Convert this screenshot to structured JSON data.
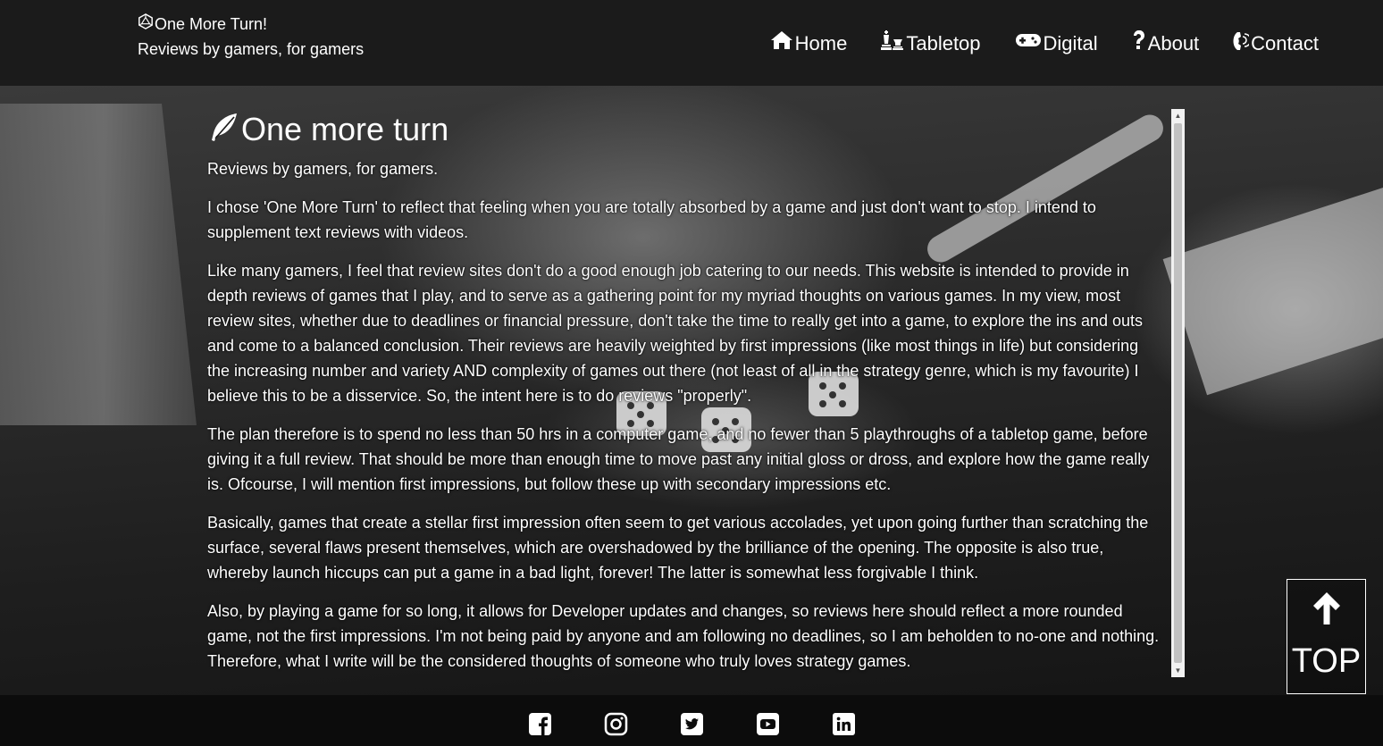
{
  "header": {
    "brand_title": "One More Turn!",
    "brand_subtitle": "Reviews by gamers, for gamers",
    "brand_icon": "d20-dice-icon"
  },
  "nav": {
    "items": [
      {
        "label": "Home",
        "icon": "home-icon"
      },
      {
        "label": "Tabletop",
        "icon": "chess-pieces-icon"
      },
      {
        "label": "Digital",
        "icon": "gamepad-icon"
      },
      {
        "label": "About",
        "icon": "question-icon"
      },
      {
        "label": "Contact",
        "icon": "phone-volume-icon"
      }
    ]
  },
  "main": {
    "title": "One more turn",
    "title_icon": "feather-icon",
    "tagline": "Reviews by gamers, for gamers.",
    "paragraphs": [
      "I chose 'One More Turn' to reflect that feeling when you are totally absorbed by a game and just don't want to stop. I intend to supplement text reviews with videos.",
      "Like many gamers, I feel that review sites don't do a good enough job catering to our needs. This website is intended to provide in depth reviews of games that I play, and to serve as a gathering point for my myriad thoughts on various games. In my view, most review sites, whether due to deadlines or financial pressure, don't take the time to really get into a game, to explore the ins and outs and come to a balanced conclusion. Their reviews are heavily weighted by first impressions (like most things in life) but considering the increasing number and variety AND complexity of games out there (not least of all in the strategy genre, which is my favourite) I believe this to be a disservice. So, the intent here is to do reviews \"properly\".",
      "The plan therefore is to spend no less than 50 hrs in a computer game, and no fewer than 5 playthroughs of a tabletop game, before giving it a full review. That should be more than enough time to move past any initial gloss or dross, and explore how the game really is. Ofcourse, I will mention first impressions, but follow these up with secondary impressions etc.",
      "Basically, games that create a stellar first impression often seem to get various accolades, yet upon going further than scratching the surface, several flaws present themselves, which are overshadowed by the brilliance of the opening. The opposite is also true, whereby launch hiccups can put a game in a bad light, forever! The latter is somewhat less forgivable I think.",
      "Also, by playing a game for so long, it allows for Developer updates and changes, so reviews here should reflect a more rounded game, not the first impressions. I'm not being paid by anyone and am following no deadlines, so I am beholden to no-one and nothing. Therefore, what I write will be the considered thoughts of someone who truly loves strategy games."
    ]
  },
  "back_to_top": {
    "label": "TOP",
    "icon": "arrow-up-icon"
  },
  "footer": {
    "social": [
      "facebook-icon",
      "instagram-icon",
      "twitter-icon",
      "youtube-icon",
      "linkedin-icon"
    ]
  },
  "colors": {
    "header_bg": "#1b1b1b",
    "footer_bg": "#0c0c0c",
    "text": "#ffffff"
  }
}
